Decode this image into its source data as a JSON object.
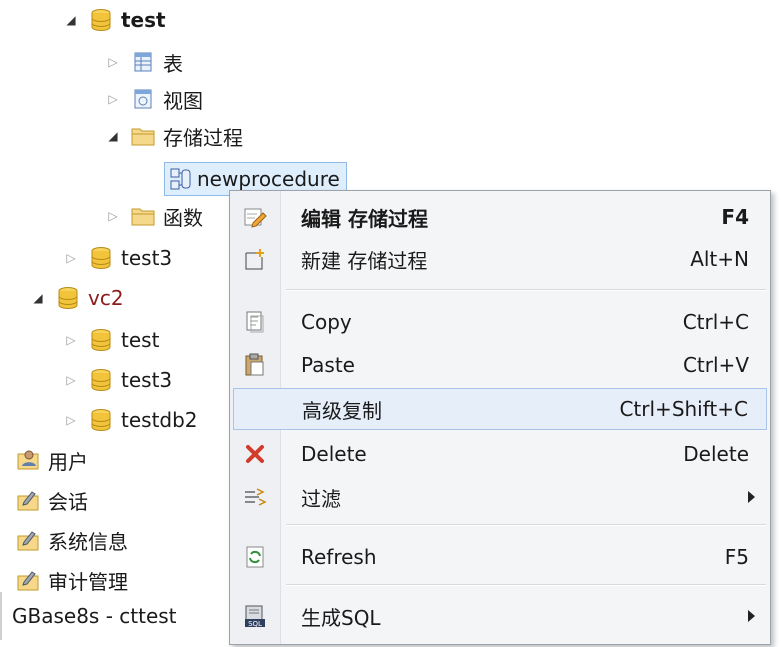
{
  "tree": {
    "db_test": "test",
    "table": "表",
    "view": "视图",
    "procedure": "存储过程",
    "newprocedure": "newprocedure",
    "function": "函数",
    "db_test3": "test3",
    "vc2": "vc2",
    "vc2_test": "test",
    "vc2_test3": "test3",
    "vc2_testdb2": "testdb2",
    "users": "用户",
    "sessions": "会话",
    "sysinfo": "系统信息",
    "audit": "审计管理",
    "connection": "GBase8s - cttest"
  },
  "menu": {
    "edit": {
      "label": "编辑 存储过程",
      "shortcut": "F4"
    },
    "new": {
      "label": "新建 存储过程",
      "shortcut": "Alt+N"
    },
    "copy": {
      "label": "Copy",
      "shortcut": "Ctrl+C"
    },
    "paste": {
      "label": "Paste",
      "shortcut": "Ctrl+V"
    },
    "advcopy": {
      "label": "高级复制",
      "shortcut": "Ctrl+Shift+C"
    },
    "delete": {
      "label": "Delete",
      "shortcut": "Delete"
    },
    "filter": {
      "label": "过滤"
    },
    "refresh": {
      "label": "Refresh",
      "shortcut": "F5"
    },
    "gensql": {
      "label": "生成SQL"
    }
  },
  "colors": {
    "db_icon": "#f2c43c",
    "folder": "#f5d88a",
    "selected_bg": "#dfeefd",
    "menu_hover": "#e6eef9",
    "delete_x": "#d23a2a"
  },
  "icons": [
    "database-icon",
    "table-icon",
    "view-icon",
    "folder-icon",
    "procedure-icon",
    "user-icon",
    "session-icon",
    "edit-icon",
    "new-icon",
    "copy-icon",
    "paste-icon",
    "delete-icon",
    "filter-icon",
    "refresh-icon",
    "sql-icon"
  ]
}
